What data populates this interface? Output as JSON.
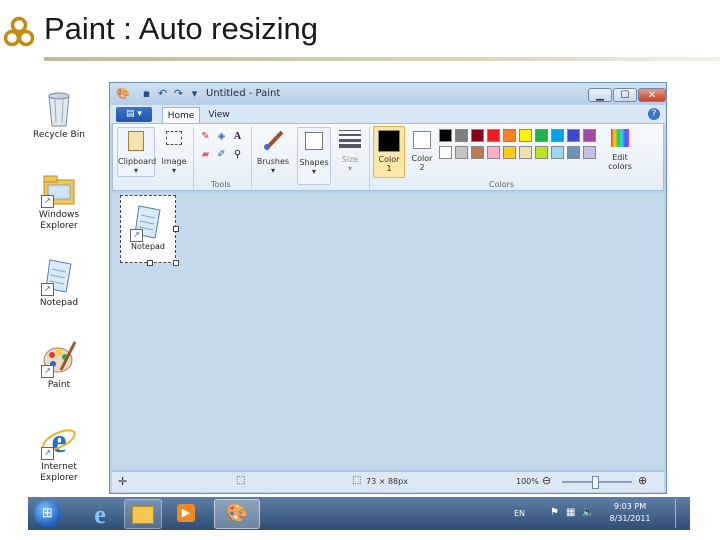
{
  "slide": {
    "title": "Paint : Auto resizing"
  },
  "desktop": {
    "icons": [
      {
        "label": "Recycle Bin",
        "icon": "recycle-bin-icon"
      },
      {
        "label": "Windows Explorer",
        "icon": "folder-icon"
      },
      {
        "label": "Notepad",
        "icon": "notepad-icon"
      },
      {
        "label": "Paint",
        "icon": "paint-palette-icon"
      },
      {
        "label": "Internet Explorer",
        "icon": "internet-explorer-icon"
      }
    ]
  },
  "paint": {
    "title": "Untitled - Paint",
    "tabs": {
      "file": "▤ ▾",
      "home": "Home",
      "view": "View"
    },
    "ribbon": {
      "clipboard": "Clipboard",
      "image": "Image",
      "tools_group": "Tools",
      "brushes": "Brushes",
      "shapes": "Shapes",
      "size": "Size",
      "color1": "Color 1",
      "color2": "Color 2",
      "colors_group": "Colors",
      "edit_colors": "Edit colors"
    },
    "palette_row1": [
      "#000000",
      "#7f7f7f",
      "#880015",
      "#ed1c24",
      "#ff7f27",
      "#fff200",
      "#22b14c",
      "#00a2e8",
      "#3f48cc",
      "#a349a4"
    ],
    "palette_row2": [
      "#ffffff",
      "#c3c3c3",
      "#b97a57",
      "#ffaec9",
      "#ffc90e",
      "#efe4b0",
      "#b5e61d",
      "#99d9ea",
      "#7092be",
      "#c8bfe7"
    ],
    "canvas_item": {
      "label": "Notepad"
    },
    "status": {
      "dimensions": "73 × 88px",
      "zoom": "100%"
    }
  },
  "taskbar": {
    "language": "EN",
    "time": "9:03 PM",
    "date": "8/31/2011"
  }
}
